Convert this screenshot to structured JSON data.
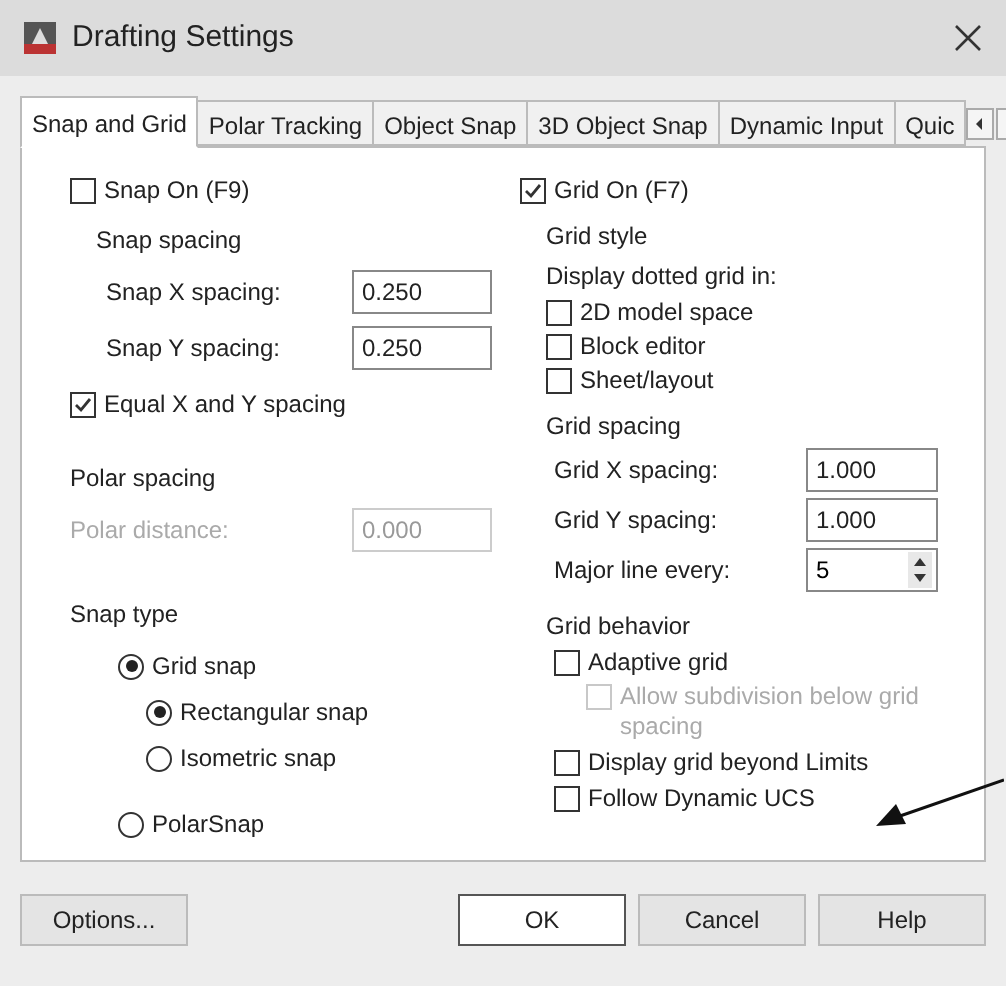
{
  "window": {
    "title": "Drafting Settings"
  },
  "tabs": [
    {
      "label": "Snap and Grid",
      "selected": true
    },
    {
      "label": "Polar Tracking",
      "selected": false
    },
    {
      "label": "Object Snap",
      "selected": false
    },
    {
      "label": "3D Object Snap",
      "selected": false
    },
    {
      "label": "Dynamic Input",
      "selected": false
    },
    {
      "label": "Quic",
      "selected": false
    }
  ],
  "snap_on": {
    "label": "Snap On (F9)",
    "checked": false
  },
  "snap_spacing": {
    "title": "Snap spacing",
    "fields": [
      {
        "label": "Snap X spacing:",
        "value": "0.250"
      },
      {
        "label": "Snap Y spacing:",
        "value": "0.250"
      }
    ]
  },
  "equal_xy": {
    "label": "Equal X and Y spacing",
    "checked": true
  },
  "polar_spacing": {
    "title": "Polar spacing",
    "field": {
      "label": "Polar distance:",
      "value": "0.000",
      "disabled": true
    }
  },
  "snap_type": {
    "title": "Snap type",
    "options": [
      {
        "label": "Grid snap",
        "selected": true,
        "children": [
          {
            "label": "Rectangular snap",
            "selected": true
          },
          {
            "label": "Isometric snap",
            "selected": false
          }
        ]
      },
      {
        "label": "PolarSnap",
        "selected": false
      }
    ]
  },
  "grid_on": {
    "label": "Grid On (F7)",
    "checked": true
  },
  "grid_style": {
    "title": "Grid style",
    "subtitle": "Display dotted grid in:",
    "options": [
      {
        "label": "2D model space",
        "checked": false
      },
      {
        "label": "Block editor",
        "checked": false
      },
      {
        "label": "Sheet/layout",
        "checked": false
      }
    ]
  },
  "grid_spacing": {
    "title": "Grid spacing",
    "fields": [
      {
        "label": "Grid X spacing:",
        "value": "1.000",
        "kind": "text"
      },
      {
        "label": "Grid Y spacing:",
        "value": "1.000",
        "kind": "text"
      },
      {
        "label": "Major line every:",
        "value": "5",
        "kind": "spinner"
      }
    ]
  },
  "grid_behavior": {
    "title": "Grid behavior",
    "options": [
      {
        "label": "Adaptive grid",
        "checked": false,
        "disabled": false,
        "children": [
          {
            "label": "Allow subdivision below grid spacing",
            "checked": false,
            "disabled": true
          }
        ]
      },
      {
        "label": "Display grid beyond Limits",
        "checked": false,
        "disabled": false
      },
      {
        "label": "Follow Dynamic UCS",
        "checked": false,
        "disabled": false
      }
    ]
  },
  "buttons": [
    {
      "label": "Options...",
      "kind": "normal"
    },
    {
      "label": "OK",
      "kind": "default"
    },
    {
      "label": "Cancel",
      "kind": "normal"
    },
    {
      "label": "Help",
      "kind": "normal"
    }
  ]
}
